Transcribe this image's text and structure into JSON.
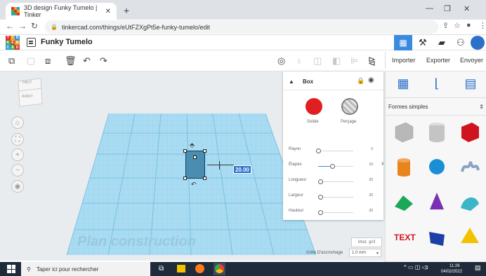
{
  "browser": {
    "tab_title": "3D design Funky Tumelo | Tinker",
    "url": "tinkercad.com/things/eUtFZXgPt5e-funky-tumelo/edit"
  },
  "app": {
    "logo_letters": [
      "T",
      "I",
      "N",
      "K",
      "E",
      "R",
      "C",
      "A",
      "D"
    ],
    "project_title": "Funky Tumelo",
    "header_actions": {
      "import": "Importer",
      "export": "Exporter",
      "send": "Envoyer"
    }
  },
  "viewcube": {
    "top_label": "HAUT",
    "front_label": "AVANT"
  },
  "workplane": {
    "watermark": "Plan construction",
    "dimension_value": "20.00",
    "mod_grid_label": "Mod. grill",
    "snap_label": "Grille D'accrochage",
    "snap_value": "1.0 mm"
  },
  "inspector": {
    "title": "Box",
    "solid_label": "Solide",
    "hole_label": "Perçage",
    "solid_color": "#e02020",
    "params": [
      {
        "label": "Rayon",
        "value": "0",
        "level": 0.0
      },
      {
        "label": "Étapes",
        "value": "10",
        "level": 0.4
      },
      {
        "label": "Longueur",
        "value": "20",
        "level": 0.05
      },
      {
        "label": "Largeur",
        "value": "20",
        "level": 0.05
      },
      {
        "label": "Hauteur",
        "value": "20",
        "level": 0.05
      }
    ]
  },
  "shapes_panel": {
    "category": "Formes simples",
    "shapes": [
      {
        "name": "box-hole",
        "color": "#b8b8b8"
      },
      {
        "name": "cylinder-hole",
        "color": "#c4c4c4"
      },
      {
        "name": "box",
        "color": "#d0141e"
      },
      {
        "name": "cylinder",
        "color": "#e8841c"
      },
      {
        "name": "sphere",
        "color": "#1a8fd6"
      },
      {
        "name": "scribble",
        "color": "#8aa2c4"
      },
      {
        "name": "roof",
        "color": "#1aa85a"
      },
      {
        "name": "cone",
        "color": "#7b2fb5"
      },
      {
        "name": "round-roof",
        "color": "#3cb5c8"
      },
      {
        "name": "text",
        "color": "#d0141e"
      },
      {
        "name": "wedge",
        "color": "#1c3fa8"
      },
      {
        "name": "pyramid",
        "color": "#f2c200"
      }
    ]
  },
  "taskbar": {
    "search_placeholder": "Taper ici pour rechercher",
    "time": "11:26",
    "date": "04/02/2022"
  }
}
